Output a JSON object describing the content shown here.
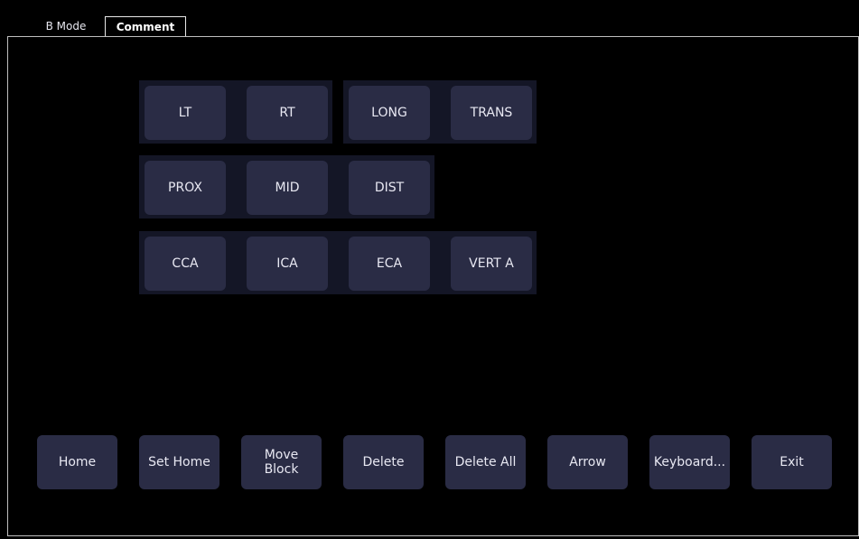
{
  "tabs": [
    {
      "label": "B Mode",
      "active": false
    },
    {
      "label": "Comment",
      "active": true
    }
  ],
  "comment_rows": [
    {
      "groups": [
        [
          "LT",
          "RT"
        ],
        [
          "LONG",
          "TRANS"
        ]
      ]
    },
    {
      "groups": [
        [
          "PROX",
          "MID",
          "DIST"
        ]
      ]
    },
    {
      "groups": [
        [
          "CCA",
          "ICA",
          "ECA",
          "VERT A"
        ]
      ]
    }
  ],
  "actions": [
    "Home",
    "Set Home",
    "Move\nBlock",
    "Delete",
    "Delete All",
    "Arrow",
    "Keyboard...",
    "Exit"
  ],
  "colors": {
    "background": "#000000",
    "button": "#2a2c45",
    "group_bg": "#141626",
    "text": "#e8e8f2",
    "panel_border": "#bfbfbf"
  }
}
